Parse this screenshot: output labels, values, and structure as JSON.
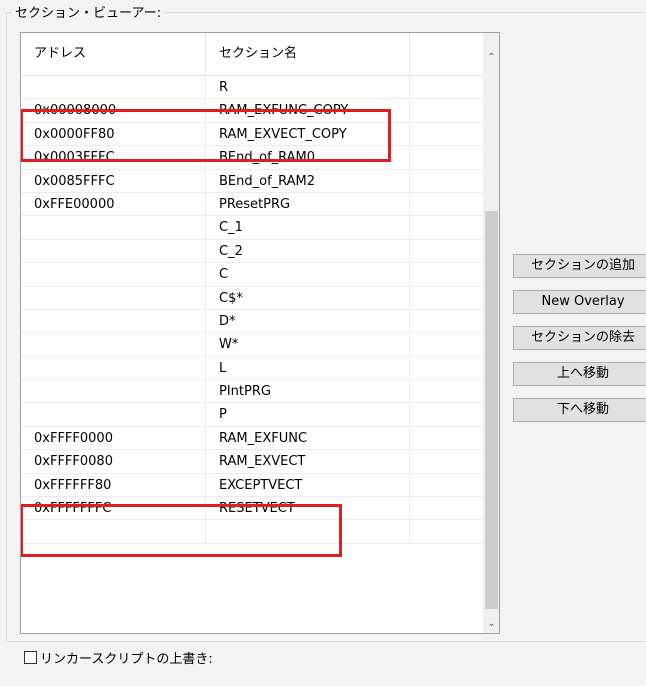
{
  "section_viewer": {
    "title": "セクション・ビューアー:",
    "columns": [
      "アドレス",
      "セクション名",
      ""
    ],
    "rows": [
      {
        "address": "",
        "name": "R"
      },
      {
        "address": "0x00008000",
        "name": "RAM_EXFUNC_COPY"
      },
      {
        "address": "0x0000FF80",
        "name": "RAM_EXVECT_COPY"
      },
      {
        "address": "0x0003FFFC",
        "name": "BEnd_of_RAM0"
      },
      {
        "address": "0x0085FFFC",
        "name": "BEnd_of_RAM2"
      },
      {
        "address": "0xFFE00000",
        "name": "PResetPRG"
      },
      {
        "address": "",
        "name": "C_1"
      },
      {
        "address": "",
        "name": "C_2"
      },
      {
        "address": "",
        "name": "C"
      },
      {
        "address": "",
        "name": "C$*"
      },
      {
        "address": "",
        "name": "D*"
      },
      {
        "address": "",
        "name": "W*"
      },
      {
        "address": "",
        "name": "L"
      },
      {
        "address": "",
        "name": "PIntPRG"
      },
      {
        "address": "",
        "name": "P"
      },
      {
        "address": "0xFFFF0000",
        "name": "RAM_EXFUNC"
      },
      {
        "address": "0xFFFF0080",
        "name": "RAM_EXVECT"
      },
      {
        "address": "0xFFFFFF80",
        "name": "EXCEPTVECT"
      },
      {
        "address": "0xFFFFFFFC",
        "name": "RESETVECT"
      },
      {
        "address": "",
        "name": ""
      }
    ],
    "highlight_color": "#e02020"
  },
  "buttons": {
    "add_section": "セクションの追加",
    "new_overlay": "New Overlay",
    "remove_section": "セクションの除去",
    "move_up": "上へ移動",
    "move_down": "下へ移動"
  },
  "override_checkbox": {
    "label": "リンカースクリプトの上書き:",
    "checked": false
  },
  "icons": {
    "scroll_up": "chevron-up-icon",
    "scroll_down": "chevron-down-icon"
  }
}
